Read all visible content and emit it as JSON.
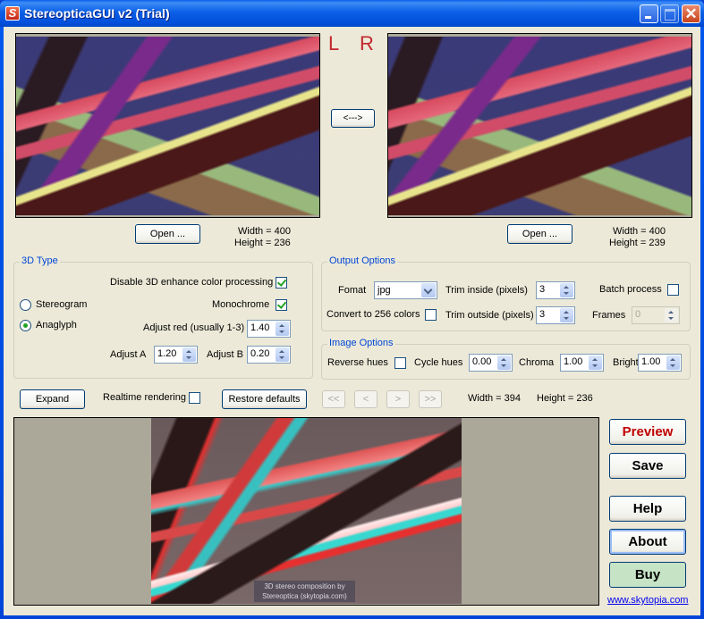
{
  "window": {
    "title": "StereopticaGUI v2 (Trial)",
    "app_icon": "S",
    "controls": {
      "minimize": "minimize",
      "maximize": "maximize",
      "close": "✕"
    }
  },
  "stereo_labels": {
    "left": "L",
    "right": "R"
  },
  "swap_button": "<--->",
  "left_image": {
    "open_label": "Open ...",
    "width_text": "Width = 400",
    "height_text": "Height = 236"
  },
  "right_image": {
    "open_label": "Open ...",
    "width_text": "Width = 400",
    "height_text": "Height = 239"
  },
  "type_group": {
    "title": "3D Type",
    "disable_enhance": {
      "label": "Disable 3D enhance color processing",
      "checked": true
    },
    "monochrome": {
      "label": "Monochrome",
      "checked": true
    },
    "stereogram": {
      "label": "Stereogram",
      "selected": false
    },
    "anaglyph": {
      "label": "Anaglyph",
      "selected": true
    },
    "adjust_red": {
      "label": "Adjust red (usually 1-3)",
      "value": "1.40"
    },
    "adjust_a": {
      "label": "Adjust A",
      "value": "1.20"
    },
    "adjust_b": {
      "label": "Adjust B",
      "value": "0.20"
    }
  },
  "output_group": {
    "title": "Output Options",
    "format": {
      "label": "Fomat",
      "value": "jpg"
    },
    "trim_inside": {
      "label": "Trim inside (pixels)",
      "value": "3"
    },
    "batch_process": {
      "label": "Batch process",
      "checked": false
    },
    "convert_256": {
      "label": "Convert to 256 colors",
      "checked": false
    },
    "trim_outside": {
      "label": "Trim outside (pixels)",
      "value": "3"
    },
    "frames": {
      "label": "Frames",
      "value": "0",
      "disabled": true
    }
  },
  "image_group": {
    "title": "Image Options",
    "reverse_hues": {
      "label": "Reverse hues",
      "checked": false
    },
    "cycle_hues": {
      "label": "Cycle hues",
      "value": "0.00"
    },
    "chroma": {
      "label": "Chroma",
      "value": "1.00"
    },
    "bright": {
      "label": "Bright",
      "value": "1.00"
    }
  },
  "toolbar": {
    "expand": "Expand",
    "realtime": {
      "label": "Realtime rendering",
      "checked": false
    },
    "restore": "Restore defaults",
    "nav_first": "<<",
    "nav_prev": "<",
    "nav_next": ">",
    "nav_last": ">>",
    "width_text": "Width = 394",
    "height_text": "Height = 236"
  },
  "output_preview": {
    "watermark_line1": "3D stereo composition by",
    "watermark_line2": "Stereoptica (skytopia.com)"
  },
  "actions": {
    "preview": "Preview",
    "save": "Save",
    "help": "Help",
    "about": "About",
    "buy": "Buy",
    "website": "www.skytopia.com"
  },
  "colors": {
    "preview_text": "#c00000",
    "buy_bg": "#c6e3c6",
    "group_title": "#0046d5",
    "lr_label": "#c1272d"
  }
}
